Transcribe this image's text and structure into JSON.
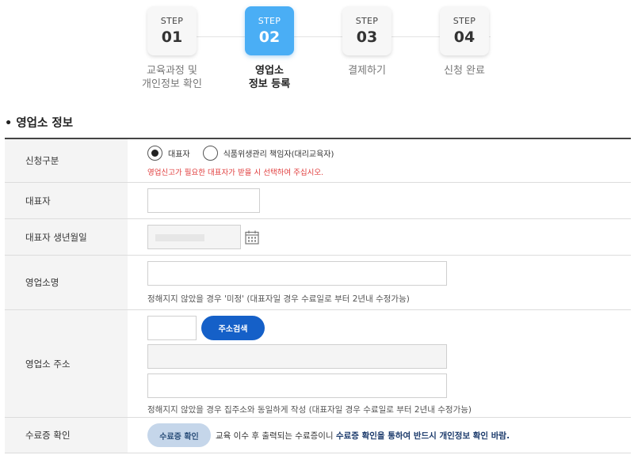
{
  "steps": [
    {
      "label": "STEP",
      "num": "01",
      "title": "교육과정 및\n개인정보 확인",
      "active": false
    },
    {
      "label": "STEP",
      "num": "02",
      "title": "영업소\n정보 등록",
      "active": true
    },
    {
      "label": "STEP",
      "num": "03",
      "title": "결제하기",
      "active": false
    },
    {
      "label": "STEP",
      "num": "04",
      "title": "신청 완료",
      "active": false
    }
  ],
  "section_title": "• 영업소 정보",
  "form": {
    "apply_type": {
      "label": "신청구분",
      "options": [
        "대표자",
        "식품위생관리 책임자(대리교육자)"
      ],
      "selected": "대표자",
      "warning": "영업신고가 필요한 대표자가 받을 시 선택하여 주십시오."
    },
    "representative": {
      "label": "대표자",
      "value": ""
    },
    "birth": {
      "label": "대표자 생년월일",
      "calendar_icon": "calendar-icon"
    },
    "business_name": {
      "label": "영업소명",
      "value": "",
      "note": "정해지지 않았을 경우 '미정' (대표자일 경우 수료일로 부터 2년내 수정가능)"
    },
    "address": {
      "label": "영업소 주소",
      "search_button": "주소검색",
      "note": "정해지지 않았을 경우 집주소와 동일하게 작성 (대표자일 경우 수료일로 부터 2년내 수정가능)"
    },
    "certificate": {
      "label": "수료증 확인",
      "button": "수료증 확인",
      "text_normal": "교육 이수 후 출력되는 수료증이니 ",
      "text_bold": "수료증 확인을 통하여 반드시 개인정보 확인 바람."
    }
  },
  "colors": {
    "accent": "#4aaef5",
    "button_blue": "#1560c8",
    "warning": "#e03c3c"
  }
}
